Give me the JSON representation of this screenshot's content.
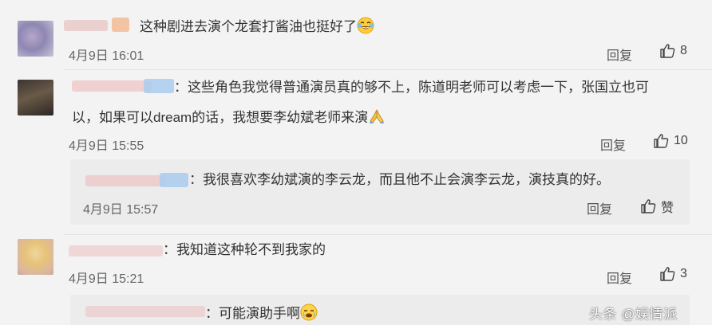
{
  "comments": [
    {
      "text": "这种剧进去演个龙套打酱油也挺好了",
      "time": "4月9日 16:01",
      "reply_label": "回复",
      "likes": "8",
      "emoji": "laughing-crying-emoji"
    },
    {
      "text_line1": "：这些角色我觉得普通演员真的够不上，陈道明老师可以考虑一下，张国立也可",
      "text_line2": "以，如果可以dream的话，我想要李幼斌老师来演",
      "time": "4月9日 15:55",
      "reply_label": "回复",
      "likes": "10",
      "emoji": "praying-hands-emoji",
      "sub_reply": {
        "text": "：我很喜欢李幼斌演的李云龙，而且他不止会演李云龙，演技真的好。",
        "time": "4月9日 15:57",
        "reply_label": "回复",
        "likes": "赞"
      }
    },
    {
      "text": "：我知道这种轮不到我家的",
      "time": "4月9日 15:21",
      "reply_label": "回复",
      "likes": "3",
      "sub_reply": {
        "text": "：可能演助手啊",
        "emoji": "crying-face-emoji"
      }
    }
  ],
  "watermark": "头条 @娱情派",
  "colors": {
    "background": "#f3f3f3",
    "sub_reply_background": "#ececec",
    "blurred_name": "#e8b9b9",
    "blurred_badge": "#9fc3ea"
  }
}
